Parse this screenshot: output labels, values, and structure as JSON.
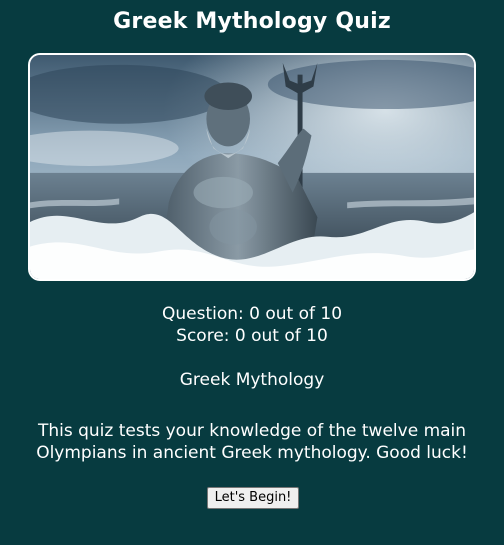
{
  "header": {
    "title": "Greek Mythology Quiz"
  },
  "hero": {
    "image_name": "poseidon-statue-image"
  },
  "status": {
    "question": "Question: 0 out of 10",
    "score": "Score: 0 out of 10"
  },
  "quiz": {
    "topic": "Greek Mythology",
    "description": "This quiz tests your knowledge of the twelve main Olympians in ancient Greek mythology. Good luck!",
    "begin_label": "Let's Begin!"
  },
  "colors": {
    "background": "#073b40",
    "text": "#ffffff",
    "button_bg": "#efefef"
  }
}
